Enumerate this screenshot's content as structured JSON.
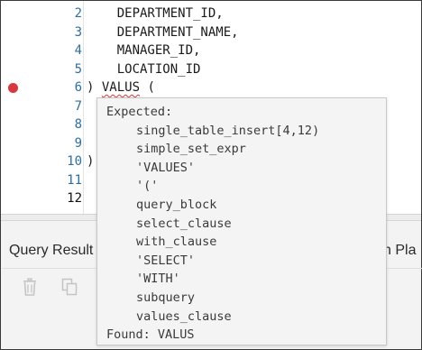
{
  "editor": {
    "lines": [
      {
        "number": "2",
        "code": "    DEPARTMENT_ID,"
      },
      {
        "number": "3",
        "code": "    DEPARTMENT_NAME,"
      },
      {
        "number": "4",
        "code": "    MANAGER_ID,"
      },
      {
        "number": "5",
        "code": "    LOCATION_ID"
      },
      {
        "number": "6",
        "code_prefix": ") ",
        "code_error": "VALUS",
        "code_suffix": " ("
      },
      {
        "number": "7",
        "code": ""
      },
      {
        "number": "8",
        "code": ""
      },
      {
        "number": "9",
        "code": ""
      },
      {
        "number": "10",
        "code": ");"
      },
      {
        "number": "11",
        "code": ""
      },
      {
        "number": "12",
        "code": ""
      }
    ]
  },
  "tooltip": {
    "header": "Expected:",
    "items": [
      "single_table_insert[4,12)",
      "simple_set_expr",
      "'VALUES'",
      "'('",
      "query_block",
      "select_clause",
      "with_clause",
      "'SELECT'",
      "'WITH'",
      "subquery",
      "values_clause"
    ],
    "found": "Found: VALUS"
  },
  "bottom_panel": {
    "tab_query_result": "Query Result",
    "tab_plan_partial": "n Pla"
  },
  "colors": {
    "line_number": "#2d6ea3",
    "breakpoint": "#d9363e",
    "error_underline": "#d9363e",
    "tooltip_bg": "#f4f4f4"
  }
}
